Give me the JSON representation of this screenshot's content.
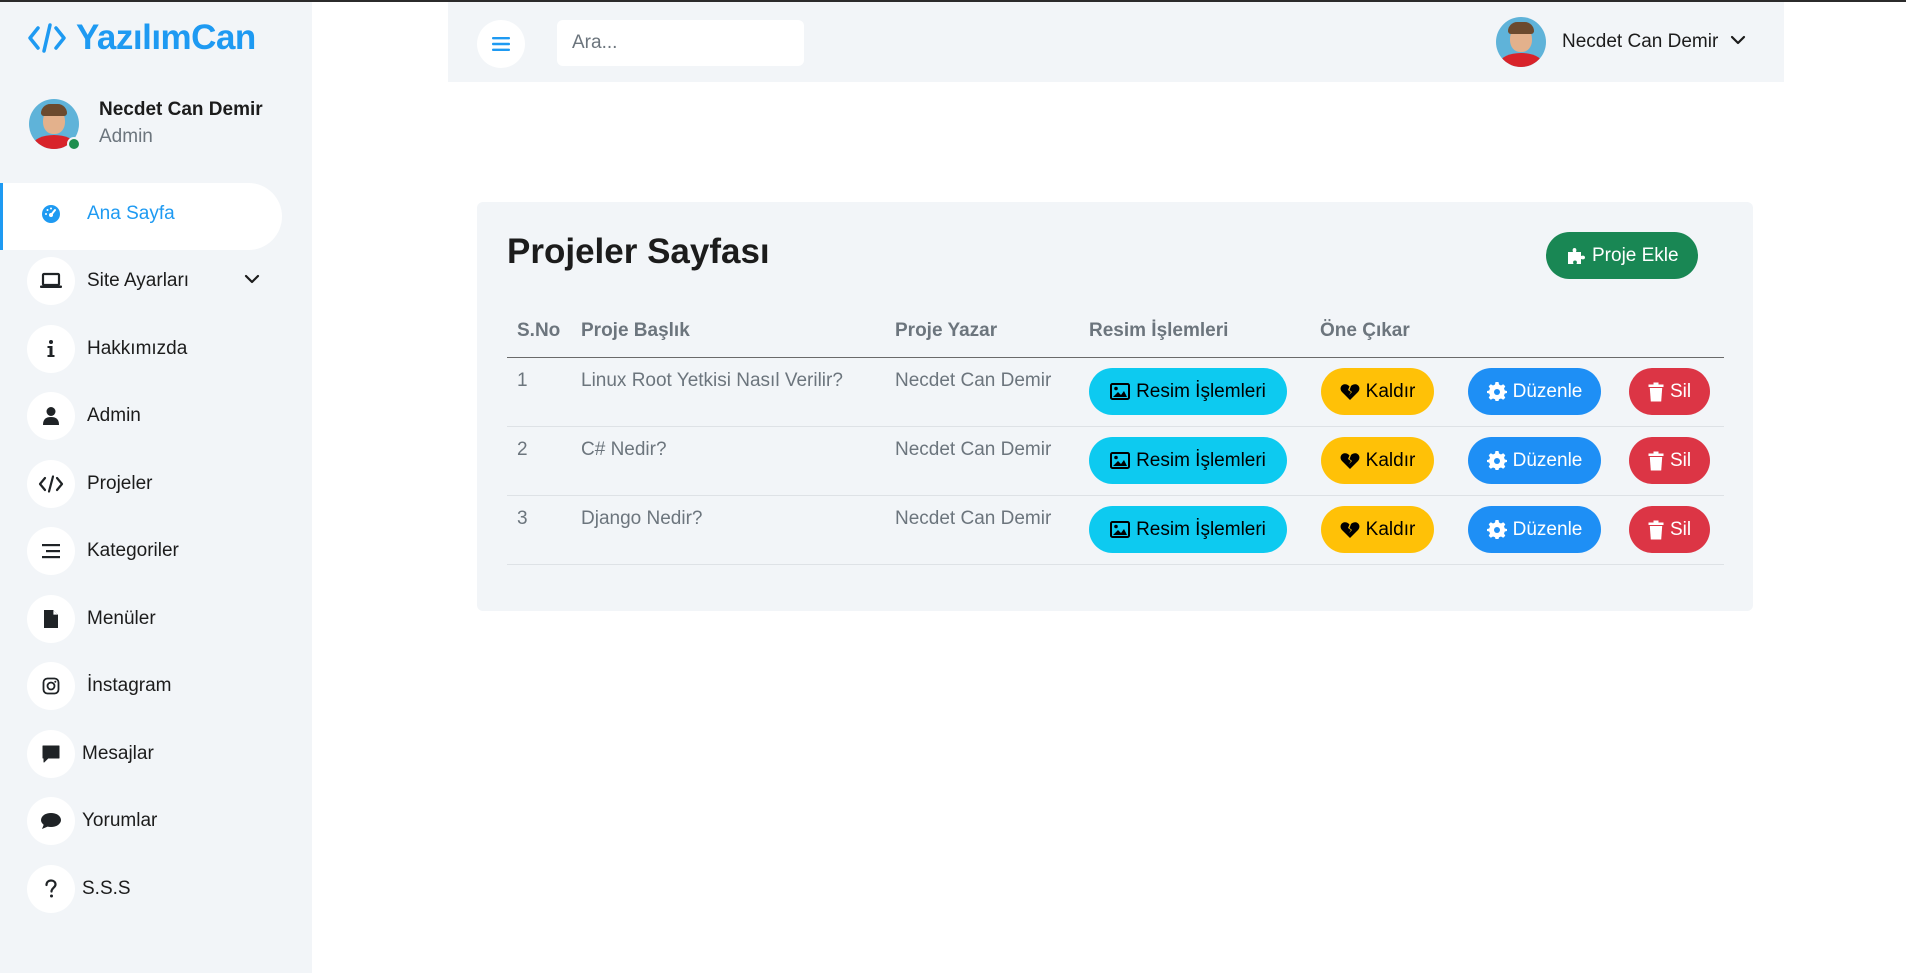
{
  "brand": {
    "name": "YazılımCan",
    "accent": "#1e9af2"
  },
  "profile": {
    "name": "Necdet Can Demir",
    "role": "Admin"
  },
  "sidebar": {
    "items": [
      {
        "label": "Ana Sayfa",
        "icon": "dashboard-icon",
        "active": true
      },
      {
        "label": "Site Ayarları",
        "icon": "laptop-icon",
        "has_submenu": true
      },
      {
        "label": "Hakkımızda",
        "icon": "info-icon"
      },
      {
        "label": "Admin",
        "icon": "user-icon"
      },
      {
        "label": "Projeler",
        "icon": "code-icon"
      },
      {
        "label": "Kategoriler",
        "icon": "align-icon"
      },
      {
        "label": "Menüler",
        "icon": "file-icon"
      },
      {
        "label": "İnstagram",
        "icon": "instagram-icon"
      },
      {
        "label": "Mesajlar",
        "icon": "message-square-icon"
      },
      {
        "label": "Yorumlar",
        "icon": "comment-icon"
      },
      {
        "label": "S.S.S",
        "icon": "question-icon"
      }
    ]
  },
  "header": {
    "search_placeholder": "Ara...",
    "user_name": "Necdet Can Demir"
  },
  "page": {
    "title": "Projeler Sayfası",
    "add_button": "Proje Ekle"
  },
  "table": {
    "columns": [
      "S.No",
      "Proje Başlık",
      "Proje Yazar",
      "Resim İşlemleri",
      "Öne Çıkar"
    ],
    "rows": [
      {
        "no": "1",
        "title": "Linux Root Yetkisi Nasıl Verilir?",
        "author": "Necdet Can Demir",
        "images": "Resim İşlemleri",
        "feature": "Kaldır",
        "edit": "Düzenle",
        "delete": "Sil"
      },
      {
        "no": "2",
        "title": "C# Nedir?",
        "author": "Necdet Can Demir",
        "images": "Resim İşlemleri",
        "feature": "Kaldır",
        "edit": "Düzenle",
        "delete": "Sil"
      },
      {
        "no": "3",
        "title": "Django Nedir?",
        "author": "Necdet Can Demir",
        "images": "Resim İşlemleri",
        "feature": "Kaldır",
        "edit": "Düzenle",
        "delete": "Sil"
      }
    ]
  },
  "colors": {
    "success": "#198754",
    "info": "#0dcaf0",
    "warning": "#ffc107",
    "primary": "#1e8ff5",
    "danger": "#dc3545",
    "panel": "#f2f5f8"
  }
}
